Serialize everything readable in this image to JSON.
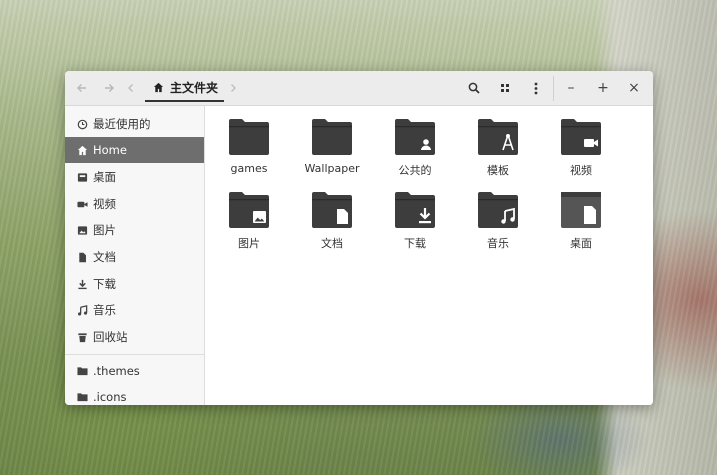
{
  "colors": {
    "sidebar_active": "#6e6e6e",
    "folder": "#3d3d3d"
  },
  "headerbar": {
    "back_icon": "arrow-left-icon",
    "forward_icon": "arrow-right-icon",
    "path": "主文件夹",
    "search_icon": "search-icon",
    "view_icon": "grid-view-icon",
    "menu_icon": "kebab-menu-icon",
    "minimize": "–",
    "maximize": "+",
    "close": "×"
  },
  "sidebar": {
    "items": [
      {
        "label": "最近使用的",
        "icon": "clock-icon"
      },
      {
        "label": "Home",
        "icon": "home-icon",
        "active": true
      },
      {
        "label": "桌面",
        "icon": "desktop-icon"
      },
      {
        "label": "视频",
        "icon": "video-icon"
      },
      {
        "label": "图片",
        "icon": "picture-icon"
      },
      {
        "label": "文档",
        "icon": "document-icon"
      },
      {
        "label": "下载",
        "icon": "download-icon"
      },
      {
        "label": "音乐",
        "icon": "music-icon"
      },
      {
        "label": "回收站",
        "icon": "trash-icon"
      }
    ],
    "bookmarks": [
      {
        "label": ".themes",
        "icon": "folder-icon"
      },
      {
        "label": ".icons",
        "icon": "folder-icon"
      }
    ]
  },
  "files": [
    {
      "name": "games",
      "icon": "folder-icon"
    },
    {
      "name": "Wallpaper",
      "icon": "folder-icon"
    },
    {
      "name": "公共的",
      "icon": "folder-public-icon"
    },
    {
      "name": "模板",
      "icon": "folder-templates-icon"
    },
    {
      "name": "视频",
      "icon": "folder-video-icon"
    },
    {
      "name": "图片",
      "icon": "folder-pictures-icon"
    },
    {
      "name": "文档",
      "icon": "folder-documents-icon"
    },
    {
      "name": "下载",
      "icon": "folder-download-icon"
    },
    {
      "name": "音乐",
      "icon": "folder-music-icon"
    },
    {
      "name": "桌面",
      "icon": "folder-desktop-icon"
    }
  ]
}
